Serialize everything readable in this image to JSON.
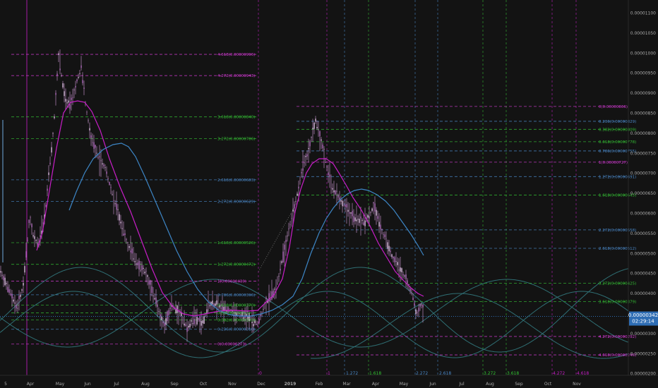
{
  "chart_data": {
    "type": "line",
    "ylim": [
      2e-06,
      1.1e-05
    ],
    "y_ticks": [
      "0.00001100",
      "0.00001050",
      "0.00001000",
      "0.00000950",
      "0.00000900",
      "0.00000850",
      "0.00000800",
      "0.00000750",
      "0.00000700",
      "0.00000650",
      "0.00000600",
      "0.00000550",
      "0.00000500",
      "0.00000450",
      "0.00000400",
      "0.00000350",
      "0.00000300",
      "0.00000250",
      "0.00000200"
    ],
    "x_ticks": [
      "5",
      "Apr",
      "May",
      "Jun",
      "Jul",
      "Aug",
      "Sep",
      "Oct",
      "Nov",
      "Dec",
      "2019",
      "Feb",
      "Mar",
      "Apr",
      "May",
      "Jun",
      "Jul",
      "Aug",
      "Sep",
      "Oct",
      "Nov"
    ],
    "current_price": "0.00000342",
    "countdown": "02:29:14",
    "grid": false,
    "fib_levels_left": [
      {
        "label": "4.618(0.00000996)",
        "value": 9.96e-06,
        "color": "#d23ad2"
      },
      {
        "label": "4.272(0.00000943)",
        "value": 9.43e-06,
        "color": "#d23ad2"
      },
      {
        "label": "3.618(0.00000840)",
        "value": 8.4e-06,
        "color": "#35c035"
      },
      {
        "label": "3.272(0.00000786)",
        "value": 7.86e-06,
        "color": "#35c035"
      },
      {
        "label": "2.618(0.00000683)",
        "value": 6.83e-06,
        "color": "#4a88c8"
      },
      {
        "label": "2.272(0.00000629)",
        "value": 6.29e-06,
        "color": "#4a88c8"
      },
      {
        "label": "1.618(0.00000526)",
        "value": 5.26e-06,
        "color": "#35c035"
      },
      {
        "label": "1.272(0.00000472)",
        "value": 4.72e-06,
        "color": "#35c035"
      },
      {
        "label": "1(0.00000430)",
        "value": 4.3e-06,
        "color": "#d23ad2"
      },
      {
        "label": "0.786(0.00000396)",
        "value": 3.96e-06,
        "color": "#4a88c8"
      },
      {
        "label": "0.618(0.00000370)",
        "value": 3.7e-06,
        "color": "#35c035"
      },
      {
        "label": "0.5(0.00000351)",
        "value": 3.51e-06,
        "color": "#35c035"
      },
      {
        "label": "0.382(0.00000333)",
        "value": 3.33e-06,
        "color": "#35c035"
      },
      {
        "label": "0.236(0.00000310)",
        "value": 3.1e-06,
        "color": "#4a88c8"
      },
      {
        "label": "0(0.00000273)",
        "value": 2.73e-06,
        "color": "#d23ad2"
      }
    ],
    "fib_levels_right": [
      {
        "label": "0(0.00000866)",
        "value": 8.66e-06,
        "color": "#d23ad2"
      },
      {
        "label": "0.236(0.00000829)",
        "value": 8.29e-06,
        "color": "#4a88c8"
      },
      {
        "label": "0.382(0.00000809)",
        "value": 8.09e-06,
        "color": "#35c035"
      },
      {
        "label": "0.618(0.00000778)",
        "value": 7.78e-06,
        "color": "#35c035"
      },
      {
        "label": "0.786(0.00000755)",
        "value": 7.55e-06,
        "color": "#4a88c8"
      },
      {
        "label": "1(0.00000727)",
        "value": 7.27e-06,
        "color": "#d23ad2"
      },
      {
        "label": "1.272(0.00000691)",
        "value": 6.91e-06,
        "color": "#4a88c8"
      },
      {
        "label": "1.618(0.00000645)",
        "value": 6.45e-06,
        "color": "#35c035"
      },
      {
        "label": "2.272(0.00000558)",
        "value": 5.58e-06,
        "color": "#4a88c8"
      },
      {
        "label": "2.618(0.00000512)",
        "value": 5.12e-06,
        "color": "#4a88c8"
      },
      {
        "label": "3.272(0.00000425)",
        "value": 4.25e-06,
        "color": "#35c035"
      },
      {
        "label": "3.618(0.00000379)",
        "value": 3.79e-06,
        "color": "#35c035"
      },
      {
        "label": "4.272(0.00000292)",
        "value": 2.92e-06,
        "color": "#d23ad2"
      },
      {
        "label": "4.618(0.00000246)",
        "value": 2.46e-06,
        "color": "#d23ad2"
      }
    ],
    "time_fib_labels": [
      "0",
      "1",
      "1.272",
      "1.618",
      "2.272",
      "2.618",
      "3.272",
      "3.618",
      "4.272",
      "4.618"
    ],
    "colors": {
      "background": "#131313",
      "candles": "#d59bdc",
      "ma_short": "#c81ec8",
      "ma_long": "#3d86c6",
      "sine": "#2f6f74",
      "current_price_bg": "#2e6db4"
    }
  }
}
